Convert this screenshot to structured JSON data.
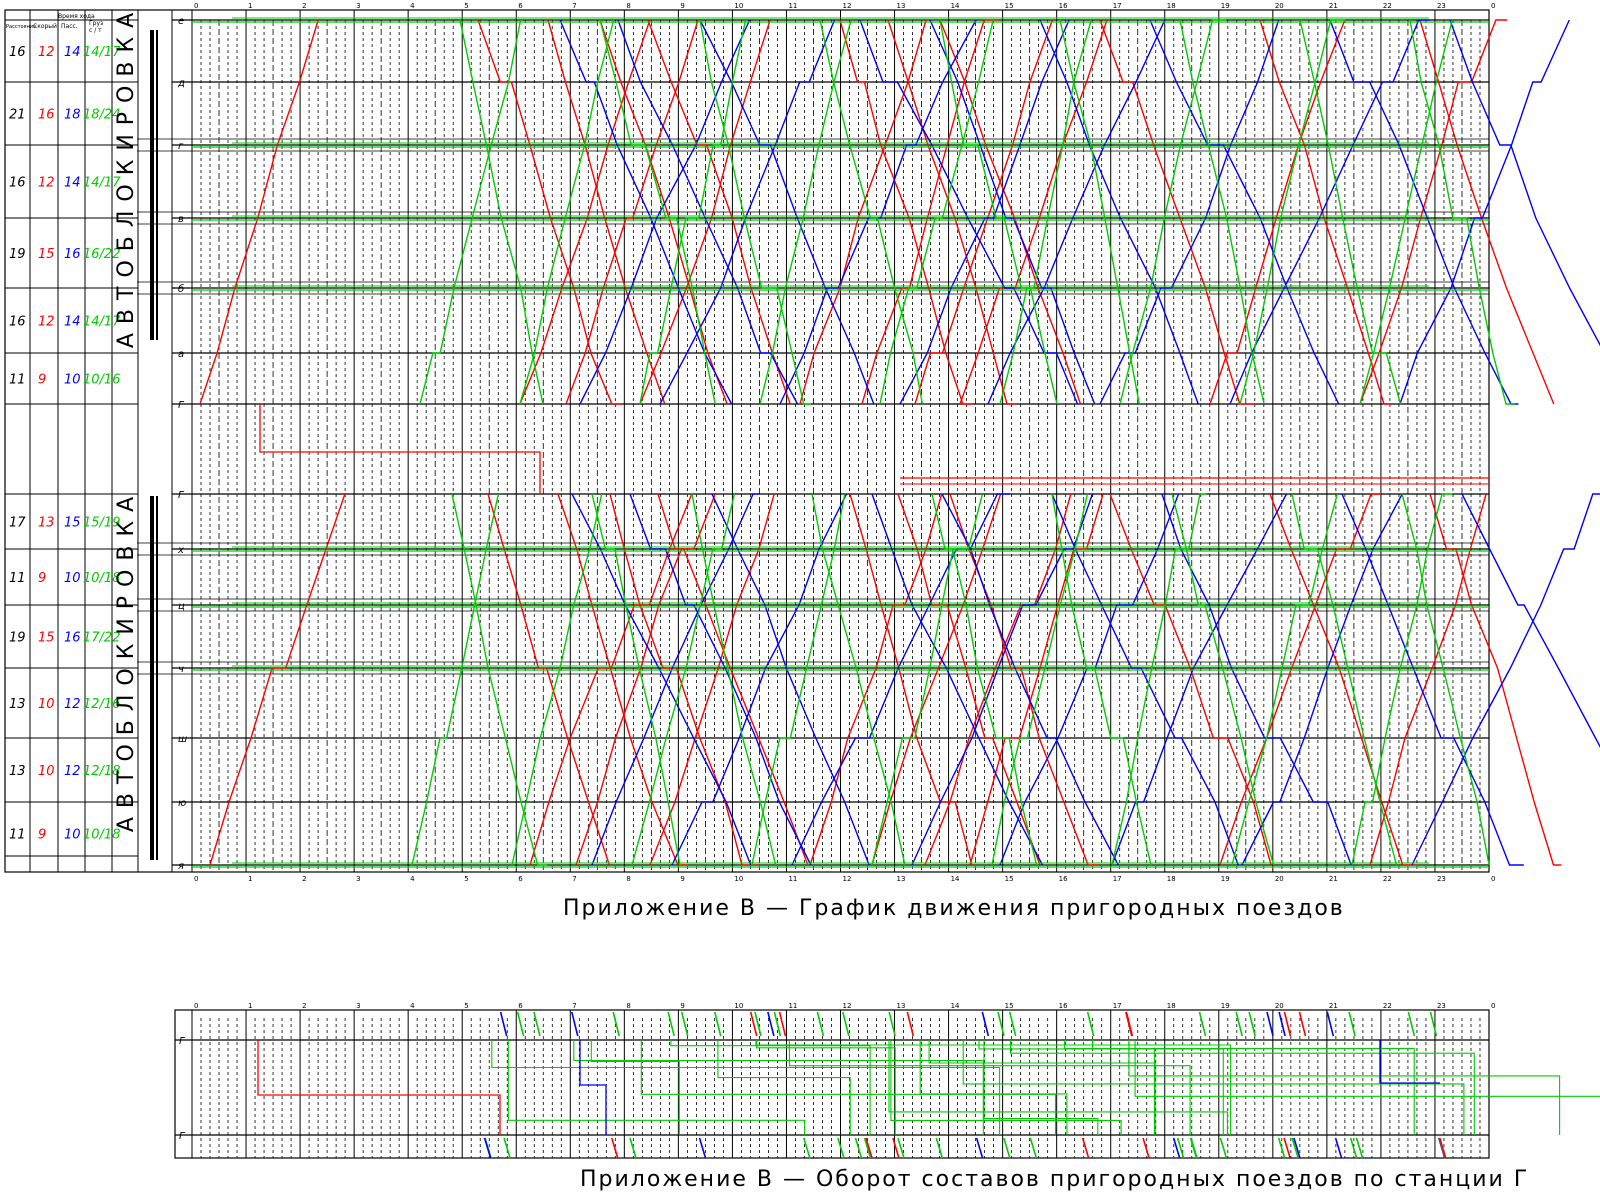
{
  "header": {
    "col_distance": "Расстояние",
    "travel_time": "Время хода",
    "col_fast": "Скорый",
    "col_pass": "Пасс.",
    "col_freight": "Груз",
    "col_freight_sub": "с / т"
  },
  "hours": [
    "0",
    "1",
    "2",
    "3",
    "4",
    "5",
    "6",
    "7",
    "8",
    "9",
    "10",
    "11",
    "12",
    "13",
    "14",
    "15",
    "16",
    "17",
    "18",
    "19",
    "20",
    "21",
    "22",
    "23",
    "0"
  ],
  "stations": [
    "е",
    "д",
    "г",
    "в",
    "б",
    "а",
    "Г",
    "Г",
    "х",
    "ц",
    "ч",
    "ш",
    "ю",
    "я"
  ],
  "segments_upper": [
    {
      "dist": "16",
      "fast": "12",
      "pass": "14",
      "freight": "14/17"
    },
    {
      "dist": "21",
      "fast": "16",
      "pass": "18",
      "freight": "18/24"
    },
    {
      "dist": "16",
      "fast": "12",
      "pass": "14",
      "freight": "14/17"
    },
    {
      "dist": "19",
      "fast": "15",
      "pass": "16",
      "freight": "16/22"
    },
    {
      "dist": "16",
      "fast": "12",
      "pass": "14",
      "freight": "14/17"
    },
    {
      "dist": "11",
      "fast": "9",
      "pass": "10",
      "freight": "10/16"
    }
  ],
  "segments_lower": [
    {
      "dist": "17",
      "fast": "13",
      "pass": "15",
      "freight": "15/19"
    },
    {
      "dist": "11",
      "fast": "9",
      "pass": "10",
      "freight": "10/18"
    },
    {
      "dist": "19",
      "fast": "15",
      "pass": "16",
      "freight": "17/22"
    },
    {
      "dist": "13",
      "fast": "10",
      "pass": "12",
      "freight": "12/16"
    },
    {
      "dist": "13",
      "fast": "10",
      "pass": "12",
      "freight": "12/18"
    },
    {
      "dist": "11",
      "fast": "9",
      "pass": "10",
      "freight": "10/18"
    }
  ],
  "block_labels": [
    "АВТОБЛОКИРОВКА",
    "АВТОБЛОКИРОВКА"
  ],
  "turnaround_stations": [
    "Г",
    "Г"
  ],
  "captions": {
    "schedule": "Приложение В — График движения пригородных поездов",
    "turnaround": "Приложение В — Оборот составов пригородных поездов по станции Г"
  },
  "colors": {
    "fast": "#ff0000",
    "passenger": "#0000ff",
    "freight": "#00cc00",
    "grid": "#000000"
  }
}
